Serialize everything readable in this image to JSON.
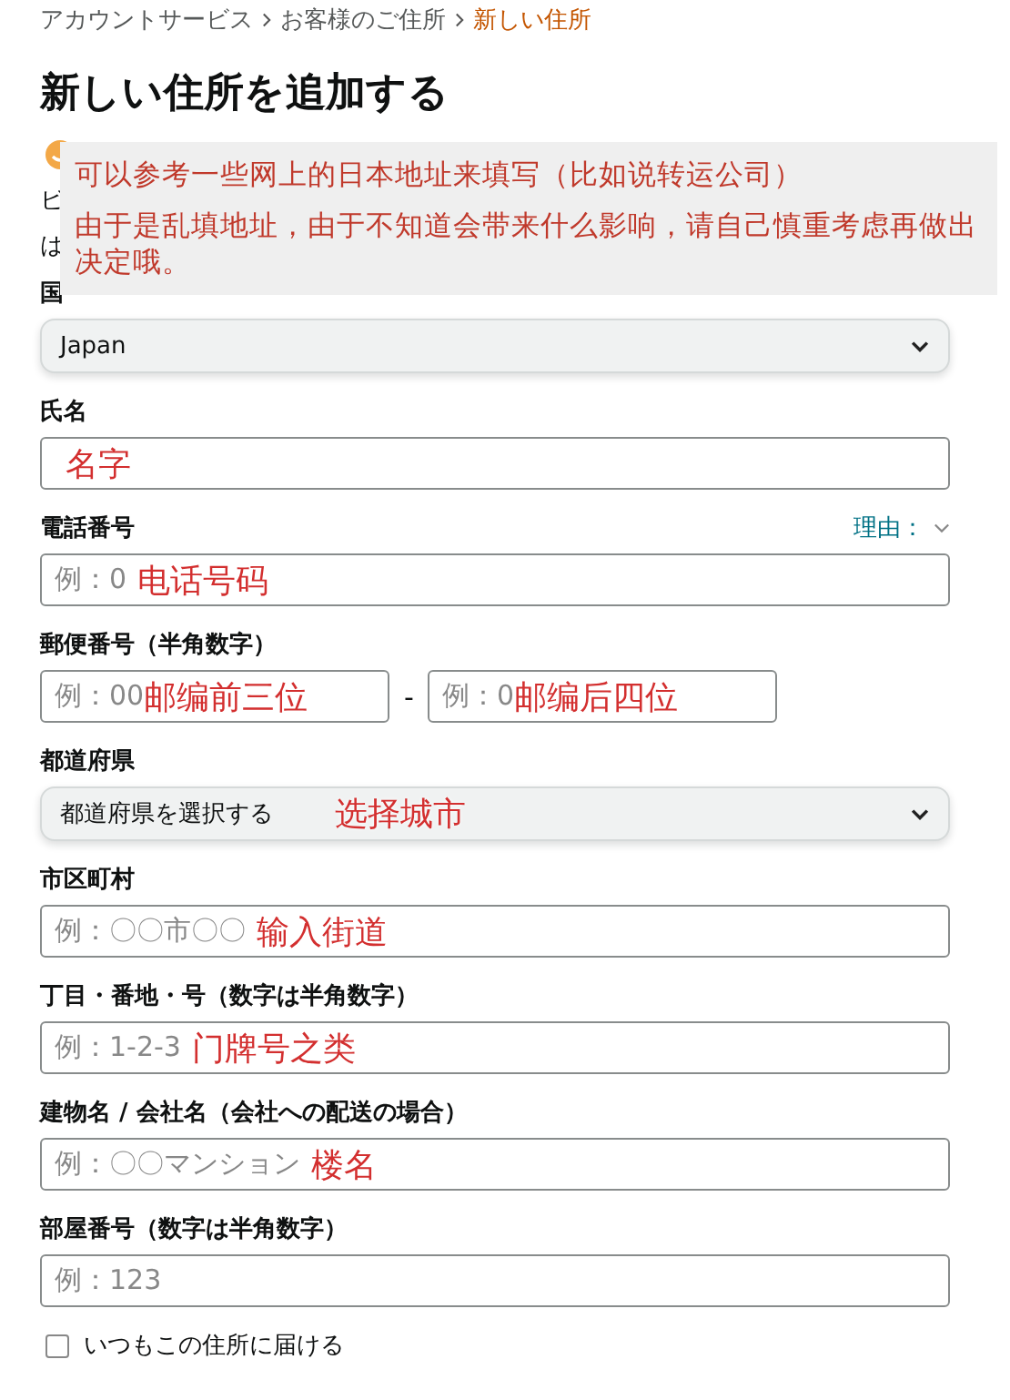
{
  "breadcrumb": [
    {
      "label": "アカウントサービス",
      "selected": false
    },
    {
      "label": "お客様のご住所",
      "selected": false
    },
    {
      "label": "新しい住所",
      "selected": true
    }
  ],
  "title": "新しい住所を追加する",
  "notice": {
    "lines": [
      "ビ",
      "は"
    ]
  },
  "overlay_note": {
    "lines": [
      "可以参考一些网上的日本地址来填写（比如说转运公司）",
      "由于是乱填地址，由于不知道会带来什么影响，请自己慎重考虑再做出决定哦。"
    ]
  },
  "fields": [
    {
      "kind": "select",
      "label": "国",
      "value": "Japan"
    },
    {
      "kind": "text",
      "label": "氏名",
      "note": "名字"
    },
    {
      "kind": "text",
      "label": "電話番号",
      "placeholder": "例：0",
      "note": "电话号码",
      "link": "理由："
    },
    {
      "kind": "split",
      "label": "郵便番号（半角数字）",
      "separator": "-",
      "parts": [
        {
          "placeholder": "例：00",
          "note": "邮编前三位"
        },
        {
          "placeholder": "例：0",
          "note": "邮编后四位"
        }
      ]
    },
    {
      "kind": "select",
      "label": "都道府県",
      "value": "都道府県を選択する",
      "note": "选择城市"
    },
    {
      "kind": "text",
      "label": "市区町村",
      "placeholder": "例：〇〇市〇〇",
      "note": "输入街道"
    },
    {
      "kind": "text",
      "label": "丁目・番地・号（数字は半角数字）",
      "placeholder": "例：1-2-3",
      "note": "门牌号之类"
    },
    {
      "kind": "text",
      "label": "建物名 / 会社名（会社への配送の場合）",
      "placeholder": "例：〇〇マンション",
      "note": "楼名"
    },
    {
      "kind": "text",
      "label": "部屋番号（数字は半角数字）",
      "placeholder": "例：123"
    }
  ],
  "checkbox": {
    "label": "いつもこの住所に届ける",
    "checked": false
  }
}
